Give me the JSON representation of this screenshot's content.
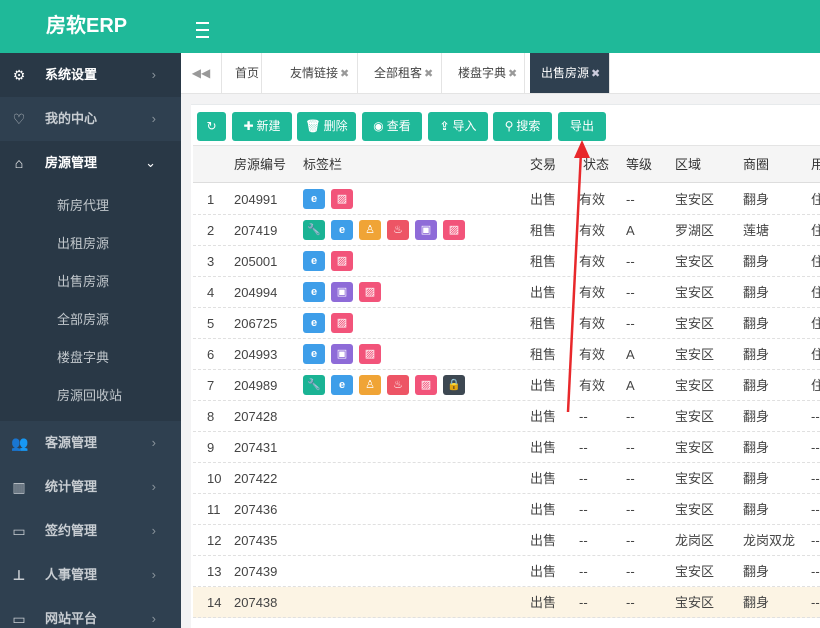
{
  "app": {
    "brand": "房软ERP"
  },
  "sidebar": {
    "items": [
      {
        "label": "系统设置",
        "icon": "gears-icon"
      },
      {
        "label": "我的中心",
        "icon": "heart-icon"
      },
      {
        "label": "房源管理",
        "icon": "home-icon"
      },
      {
        "label": "客源管理",
        "icon": "users-icon"
      },
      {
        "label": "统计管理",
        "icon": "bar-chart-icon"
      },
      {
        "label": "签约管理",
        "icon": "credit-card-icon"
      },
      {
        "label": "人事管理",
        "icon": "sitemap-icon"
      },
      {
        "label": "网站平台",
        "icon": "desktop-icon"
      }
    ],
    "sub_items": [
      "新房代理",
      "出租房源",
      "出售房源",
      "全部房源",
      "楼盘字典",
      "房源回收站"
    ]
  },
  "tabs": [
    {
      "label": "首页"
    },
    {
      "label": "友情链接"
    },
    {
      "label": "全部租客"
    },
    {
      "label": "楼盘字典"
    },
    {
      "label": "出售房源"
    }
  ],
  "toolbar": {
    "new_label": "新建",
    "delete_label": "删除",
    "view_label": "查看",
    "import_label": "导入",
    "search_label": "搜索",
    "export_label": "导出"
  },
  "table": {
    "columns": [
      "房源编号",
      "标签栏",
      "交易",
      "状态",
      "等级",
      "区域",
      "商圈",
      "用"
    ],
    "rows": [
      {
        "n": "1",
        "id": "204991",
        "tags": [
          "ie",
          "img"
        ],
        "trade": "出售",
        "status": "有效",
        "level": "--",
        "area": "宝安区",
        "circle": "翻身",
        "use": "住"
      },
      {
        "n": "2",
        "id": "207419",
        "tags": [
          "key",
          "ie",
          "person",
          "fire",
          "car",
          "img"
        ],
        "trade": "租售",
        "status": "有效",
        "level": "A",
        "area": "罗湖区",
        "circle": "莲塘",
        "use": "住"
      },
      {
        "n": "3",
        "id": "205001",
        "tags": [
          "ie",
          "img"
        ],
        "trade": "租售",
        "status": "有效",
        "level": "--",
        "area": "宝安区",
        "circle": "翻身",
        "use": "住"
      },
      {
        "n": "4",
        "id": "204994",
        "tags": [
          "ie",
          "car",
          "img"
        ],
        "trade": "出售",
        "status": "有效",
        "level": "--",
        "area": "宝安区",
        "circle": "翻身",
        "use": "住"
      },
      {
        "n": "5",
        "id": "206725",
        "tags": [
          "ie",
          "img"
        ],
        "trade": "租售",
        "status": "有效",
        "level": "--",
        "area": "宝安区",
        "circle": "翻身",
        "use": "住"
      },
      {
        "n": "6",
        "id": "204993",
        "tags": [
          "ie",
          "car",
          "img"
        ],
        "trade": "租售",
        "status": "有效",
        "level": "A",
        "area": "宝安区",
        "circle": "翻身",
        "use": "住"
      },
      {
        "n": "7",
        "id": "204989",
        "tags": [
          "key",
          "ie",
          "person",
          "fire",
          "img",
          "lock"
        ],
        "trade": "出售",
        "status": "有效",
        "level": "A",
        "area": "宝安区",
        "circle": "翻身",
        "use": "住"
      },
      {
        "n": "8",
        "id": "207428",
        "tags": [],
        "trade": "出售",
        "status": "--",
        "level": "--",
        "area": "宝安区",
        "circle": "翻身",
        "use": "--"
      },
      {
        "n": "9",
        "id": "207431",
        "tags": [],
        "trade": "出售",
        "status": "--",
        "level": "--",
        "area": "宝安区",
        "circle": "翻身",
        "use": "--"
      },
      {
        "n": "10",
        "id": "207422",
        "tags": [],
        "trade": "出售",
        "status": "--",
        "level": "--",
        "area": "宝安区",
        "circle": "翻身",
        "use": "--"
      },
      {
        "n": "11",
        "id": "207436",
        "tags": [],
        "trade": "出售",
        "status": "--",
        "level": "--",
        "area": "宝安区",
        "circle": "翻身",
        "use": "--"
      },
      {
        "n": "12",
        "id": "207435",
        "tags": [],
        "trade": "出售",
        "status": "--",
        "level": "--",
        "area": "龙岗区",
        "circle": "龙岗双龙",
        "use": "--"
      },
      {
        "n": "13",
        "id": "207439",
        "tags": [],
        "trade": "出售",
        "status": "--",
        "level": "--",
        "area": "宝安区",
        "circle": "翻身",
        "use": "--"
      },
      {
        "n": "14",
        "id": "207438",
        "tags": [],
        "trade": "出售",
        "status": "--",
        "level": "--",
        "area": "宝安区",
        "circle": "翻身",
        "use": "--"
      }
    ]
  },
  "colors": {
    "accent": "#1fb999",
    "sidebar": "#2f4050",
    "tag_green": "#1ab394",
    "tag_blue": "#3e9ee9",
    "tag_orange": "#f0a436",
    "tag_red": "#ed5565",
    "tag_purple": "#8e6bd8",
    "tag_pink": "#f2547a",
    "tag_dark": "#3d4852",
    "annotation": "#e8282b"
  }
}
